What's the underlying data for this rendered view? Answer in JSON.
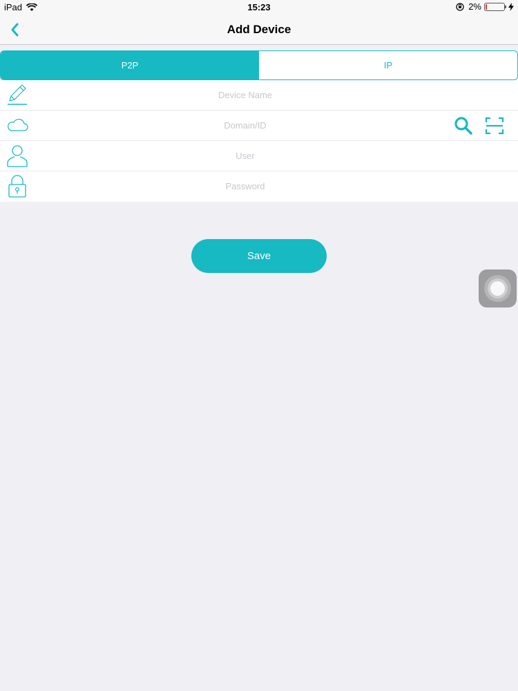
{
  "status_bar": {
    "carrier": "iPad",
    "time": "15:23",
    "battery": "2%"
  },
  "nav": {
    "title": "Add Device",
    "back_icon": "chevron-left-icon"
  },
  "tabs": [
    {
      "label": "P2P",
      "active": true
    },
    {
      "label": "IP",
      "active": false
    }
  ],
  "form": {
    "device_name": {
      "placeholder": "Device Name",
      "value": "",
      "icon": "pencil-icon"
    },
    "domain_id": {
      "placeholder": "Domain/ID",
      "value": "",
      "icon": "cloud-icon"
    },
    "user": {
      "placeholder": "User",
      "value": "",
      "icon": "user-icon"
    },
    "password": {
      "placeholder": "Password",
      "value": "",
      "icon": "lock-icon"
    }
  },
  "actions": {
    "search_icon": "search-icon",
    "scan_icon": "qr-scan-icon"
  },
  "save_label": "Save",
  "colors": {
    "accent": "#17b9c3",
    "background": "#efeff4",
    "battery_low": "#e03a2f"
  }
}
